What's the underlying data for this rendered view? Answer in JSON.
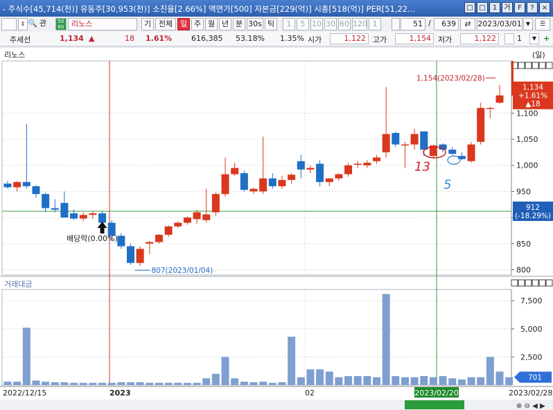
{
  "window": {
    "title": "- 주식수[45,714(천)] 유동주[30,953(천)] 소진율[2.66%] 액면가[500] 자본금[229(억)] 시총[518(억)] PER[51,22...",
    "buttons": [
      "□",
      "□",
      "1",
      "거",
      "F",
      "?",
      "×"
    ]
  },
  "toolbar": {
    "code_prefix": "관",
    "tag": "50\n60",
    "stock_name": "리노스",
    "items": [
      "기",
      "전체",
      "일",
      "주",
      "월",
      "년",
      "분",
      "30s",
      "틱"
    ],
    "active": "일",
    "minute_opts": [
      "1",
      "5",
      "10",
      "30",
      "60",
      "120",
      "1"
    ],
    "count": "51",
    "total": "639",
    "date": "2023/03/01"
  },
  "quote": {
    "mode_label": "추세선",
    "price": "1,134",
    "arrow": "▲",
    "change": "18",
    "change_pct": "1.61%",
    "volume": "616,385",
    "ratio1": "53.18%",
    "ratio2": "1.35%",
    "open_label": "시가",
    "open": "1,122",
    "high_label": "고가",
    "high": "1,154",
    "low_label": "저가",
    "low": "1,122",
    "page": "1"
  },
  "price_panel": {
    "name": "리노스",
    "unit_label": "(일)",
    "price_tag": [
      "1,134",
      "+1.61%",
      "▲18"
    ],
    "cursor_tag": [
      "912",
      "(-18.29%)"
    ],
    "high_annotation": "1,154(2023/02/28)",
    "low_annotation": "807(2023/01/04)",
    "dividend_label": "배당락(0.00%)",
    "hand_notes": [
      "13",
      "5"
    ]
  },
  "volume_panel": {
    "name": "거래대금",
    "tag": "701"
  },
  "xaxis": {
    "labels": [
      "2022/12/15",
      "2023",
      "02",
      "2023/03/01",
      "2023/02/28"
    ],
    "cursor_date": "2023/02/20"
  },
  "colors": {
    "up": "#d9381e",
    "down": "#1f6fc5",
    "volume": "#7e9fd0",
    "grid": "#d8dbe0",
    "cursor_h": "#3a9a3a",
    "marker_red": "#cc2222"
  },
  "chart_data": [
    {
      "type": "candlestick",
      "title": "리노스",
      "ylabel": "",
      "ylim": [
        790,
        1200
      ],
      "yticks": [
        800,
        850,
        900,
        950,
        1000,
        1050,
        1100
      ],
      "candles": [
        {
          "o": 965,
          "h": 970,
          "l": 955,
          "c": 958
        },
        {
          "o": 958,
          "h": 970,
          "l": 950,
          "c": 968
        },
        {
          "o": 968,
          "h": 1080,
          "l": 955,
          "c": 960
        },
        {
          "o": 960,
          "h": 962,
          "l": 938,
          "c": 945
        },
        {
          "o": 945,
          "h": 948,
          "l": 910,
          "c": 918
        },
        {
          "o": 918,
          "h": 935,
          "l": 910,
          "c": 915
        },
        {
          "o": 928,
          "h": 950,
          "l": 910,
          "c": 900
        },
        {
          "o": 908,
          "h": 915,
          "l": 895,
          "c": 898
        },
        {
          "o": 898,
          "h": 910,
          "l": 893,
          "c": 905
        },
        {
          "o": 905,
          "h": 912,
          "l": 897,
          "c": 908
        },
        {
          "o": 908,
          "h": 912,
          "l": 888,
          "c": 890
        },
        {
          "o": 890,
          "h": 895,
          "l": 855,
          "c": 865
        },
        {
          "o": 865,
          "h": 870,
          "l": 840,
          "c": 845
        },
        {
          "o": 845,
          "h": 850,
          "l": 810,
          "c": 813
        },
        {
          "o": 813,
          "h": 845,
          "l": 807,
          "c": 840
        },
        {
          "o": 850,
          "h": 855,
          "l": 830,
          "c": 853
        },
        {
          "o": 853,
          "h": 868,
          "l": 850,
          "c": 867
        },
        {
          "o": 867,
          "h": 885,
          "l": 863,
          "c": 883
        },
        {
          "o": 883,
          "h": 893,
          "l": 880,
          "c": 890
        },
        {
          "o": 890,
          "h": 902,
          "l": 886,
          "c": 900
        },
        {
          "o": 897,
          "h": 915,
          "l": 888,
          "c": 910
        },
        {
          "o": 895,
          "h": 955,
          "l": 890,
          "c": 906
        },
        {
          "o": 910,
          "h": 948,
          "l": 903,
          "c": 945
        },
        {
          "o": 945,
          "h": 1015,
          "l": 940,
          "c": 983
        },
        {
          "o": 983,
          "h": 1005,
          "l": 980,
          "c": 995
        },
        {
          "o": 985,
          "h": 990,
          "l": 950,
          "c": 953
        },
        {
          "o": 950,
          "h": 957,
          "l": 945,
          "c": 955
        },
        {
          "o": 950,
          "h": 1055,
          "l": 945,
          "c": 975
        },
        {
          "o": 975,
          "h": 985,
          "l": 955,
          "c": 960
        },
        {
          "o": 960,
          "h": 980,
          "l": 955,
          "c": 972
        },
        {
          "o": 972,
          "h": 985,
          "l": 965,
          "c": 982
        },
        {
          "o": 1008,
          "h": 1020,
          "l": 975,
          "c": 992
        },
        {
          "o": 992,
          "h": 1000,
          "l": 985,
          "c": 995
        },
        {
          "o": 1003,
          "h": 1010,
          "l": 960,
          "c": 968
        },
        {
          "o": 968,
          "h": 975,
          "l": 960,
          "c": 975
        },
        {
          "o": 975,
          "h": 985,
          "l": 970,
          "c": 983
        },
        {
          "o": 983,
          "h": 1005,
          "l": 978,
          "c": 1000
        },
        {
          "o": 1002,
          "h": 1008,
          "l": 995,
          "c": 1003
        },
        {
          "o": 1000,
          "h": 1010,
          "l": 995,
          "c": 1005
        },
        {
          "o": 1008,
          "h": 1020,
          "l": 1003,
          "c": 1015
        },
        {
          "o": 1025,
          "h": 1150,
          "l": 1015,
          "c": 1060
        },
        {
          "o": 1062,
          "h": 1065,
          "l": 1035,
          "c": 1040
        },
        {
          "o": 1040,
          "h": 1045,
          "l": 995,
          "c": 1040
        },
        {
          "o": 1040,
          "h": 1070,
          "l": 1030,
          "c": 1060
        },
        {
          "o": 1065,
          "h": 1065,
          "l": 1018,
          "c": 1030
        },
        {
          "o": 1018,
          "h": 1040,
          "l": 1013,
          "c": 1038
        },
        {
          "o": 1040,
          "h": 1042,
          "l": 1025,
          "c": 1030
        },
        {
          "o": 1030,
          "h": 1035,
          "l": 1020,
          "c": 1022
        },
        {
          "o": 1018,
          "h": 1025,
          "l": 1010,
          "c": 1012
        },
        {
          "o": 1008,
          "h": 1045,
          "l": 1005,
          "c": 1040
        },
        {
          "o": 1045,
          "h": 1120,
          "l": 1040,
          "c": 1110
        },
        {
          "o": 1108,
          "h": 1112,
          "l": 1090,
          "c": 1110
        },
        {
          "o": 1120,
          "h": 1154,
          "l": 1118,
          "c": 1134
        }
      ]
    },
    {
      "type": "bar",
      "title": "거래대금",
      "ylim": [
        0,
        8500
      ],
      "yticks": [
        2500,
        5000,
        7500
      ],
      "values": [
        300,
        300,
        5100,
        400,
        300,
        250,
        250,
        200,
        200,
        200,
        200,
        200,
        250,
        250,
        250,
        200,
        200,
        200,
        200,
        200,
        200,
        600,
        1000,
        2500,
        600,
        300,
        250,
        300,
        200,
        250,
        4300,
        700,
        1400,
        1400,
        1200,
        700,
        800,
        800,
        800,
        700,
        8100,
        800,
        700,
        700,
        800,
        700,
        800,
        600,
        500,
        700,
        700,
        2500,
        1200,
        701
      ]
    }
  ]
}
